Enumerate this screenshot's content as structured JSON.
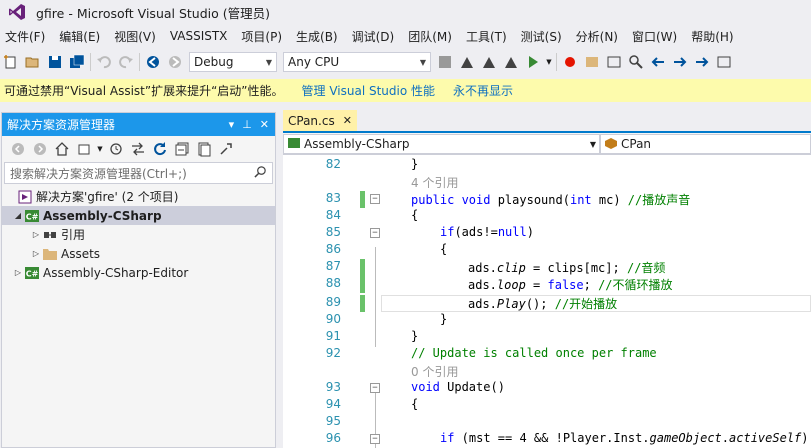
{
  "window": {
    "title": "gfire - Microsoft Visual Studio (管理员)"
  },
  "menu": [
    "文件(F)",
    "编辑(E)",
    "视图(V)",
    "VASSISTX",
    "项目(P)",
    "生成(B)",
    "调试(D)",
    "团队(M)",
    "工具(T)",
    "测试(S)",
    "分析(N)",
    "窗口(W)",
    "帮助(H)"
  ],
  "toolbar": {
    "config": "Debug",
    "platform": "Any CPU"
  },
  "infobar": {
    "message": "可通过禁用“Visual Assist”扩展来提升“启动”性能。",
    "link_manage": "管理 Visual Studio 性能",
    "link_never": "永不再显示"
  },
  "solution_explorer": {
    "title": "解决方案资源管理器",
    "search_placeholder": "搜索解决方案资源管理器(Ctrl+;)",
    "tree": {
      "solution": "解决方案'gfire' (2 个项目)",
      "project1": "Assembly-CSharp",
      "references": "引用",
      "assets": "Assets",
      "project2": "Assembly-CSharp-Editor"
    }
  },
  "editor": {
    "tab_label": "CPan.cs",
    "nav_project": "Assembly-CSharp",
    "nav_class": "CPan",
    "refs_label": "4 个引用",
    "refs_label2": "0 个引用",
    "lines": {
      "l82": "}",
      "l83_kw": "public void",
      "l83_rest": " playsound(",
      "l83_type": "int",
      "l83_end": " mc) ",
      "l83_cm": "//播放声音",
      "l84": "{",
      "l85_kw": "if",
      "l85_rest": "(ads!=",
      "l85_null": "null",
      "l85_end": ")",
      "l86": "{",
      "l87_a": "ads.",
      "l87_b": "clip",
      "l87_c": " = clips[mc]; ",
      "l87_cm": "//音频",
      "l88_a": "ads.",
      "l88_b": "loop",
      "l88_c": " = ",
      "l88_kw": "false",
      "l88_d": "; ",
      "l88_cm": "//不循环播放",
      "l89_a": "ads.",
      "l89_b": "Play",
      "l89_c": "(); ",
      "l89_cm": "//开始播放",
      "l90": "}",
      "l91": "}",
      "l92_cm": "// Update is called once per frame",
      "l93_kw": "void",
      "l93_rest": " Update()",
      "l94": "{",
      "l95": "",
      "l96_kw": "if",
      "l96_rest": " (mst == 4 && !Player.Inst.",
      "l96_it": "gameObject",
      "l96_dot": ".",
      "l96_it2": "activeSelf",
      "l96_end": ")"
    },
    "line_numbers": [
      "82",
      "83",
      "84",
      "85",
      "86",
      "87",
      "88",
      "89",
      "90",
      "91",
      "92",
      "93",
      "94",
      "95",
      "96"
    ]
  },
  "colors": {
    "accent": "#007acc",
    "panel_header": "#1c97ea",
    "infobar_bg": "#fdfbac",
    "tab_active": "#fff1a8",
    "keyword": "#0000ff",
    "comment": "#008000",
    "line_number": "#2b91af",
    "change_marker": "#6ac26a"
  },
  "icons": [
    "visual-studio-icon",
    "new-project-icon",
    "open-icon",
    "save-icon",
    "save-all-icon",
    "undo-icon",
    "redo-icon",
    "back-icon",
    "forward-icon",
    "start-icon",
    "home-icon",
    "refresh-icon",
    "collapse-icon",
    "search-icon",
    "pin-icon",
    "close-icon",
    "solution-icon",
    "csharp-project-icon",
    "references-icon",
    "folder-icon"
  ]
}
